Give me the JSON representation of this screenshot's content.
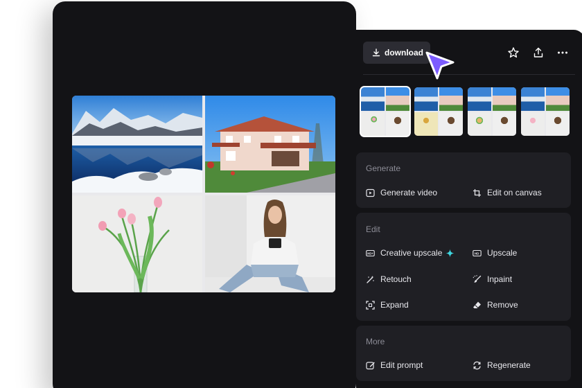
{
  "toolbar": {
    "download_label": "download",
    "download_icon": "download-icon",
    "icons": [
      "star-icon",
      "share-icon",
      "more-icon"
    ]
  },
  "collage": {
    "images": [
      "mountain-lake-photo",
      "house-photo",
      "tulips-photo",
      "woman-photo"
    ]
  },
  "thumbnails": {
    "count": 4,
    "selected_index": 0
  },
  "sections": {
    "generate": {
      "title": "Generate",
      "actions": [
        "Generate video",
        "Edit on canvas"
      ]
    },
    "edit": {
      "title": "Edit",
      "actions": [
        "Creative upscale",
        "Upscale",
        "Retouch",
        "Inpaint",
        "Expand",
        "Remove"
      ]
    },
    "more": {
      "title": "More",
      "actions": [
        "Edit prompt",
        "Regenerate"
      ]
    }
  },
  "colors": {
    "panel": "#131316",
    "section": "#1f1f24",
    "button": "#2c2c33",
    "accent_sparkle": "#3fd6e0",
    "cursor": "#7c5cff"
  }
}
